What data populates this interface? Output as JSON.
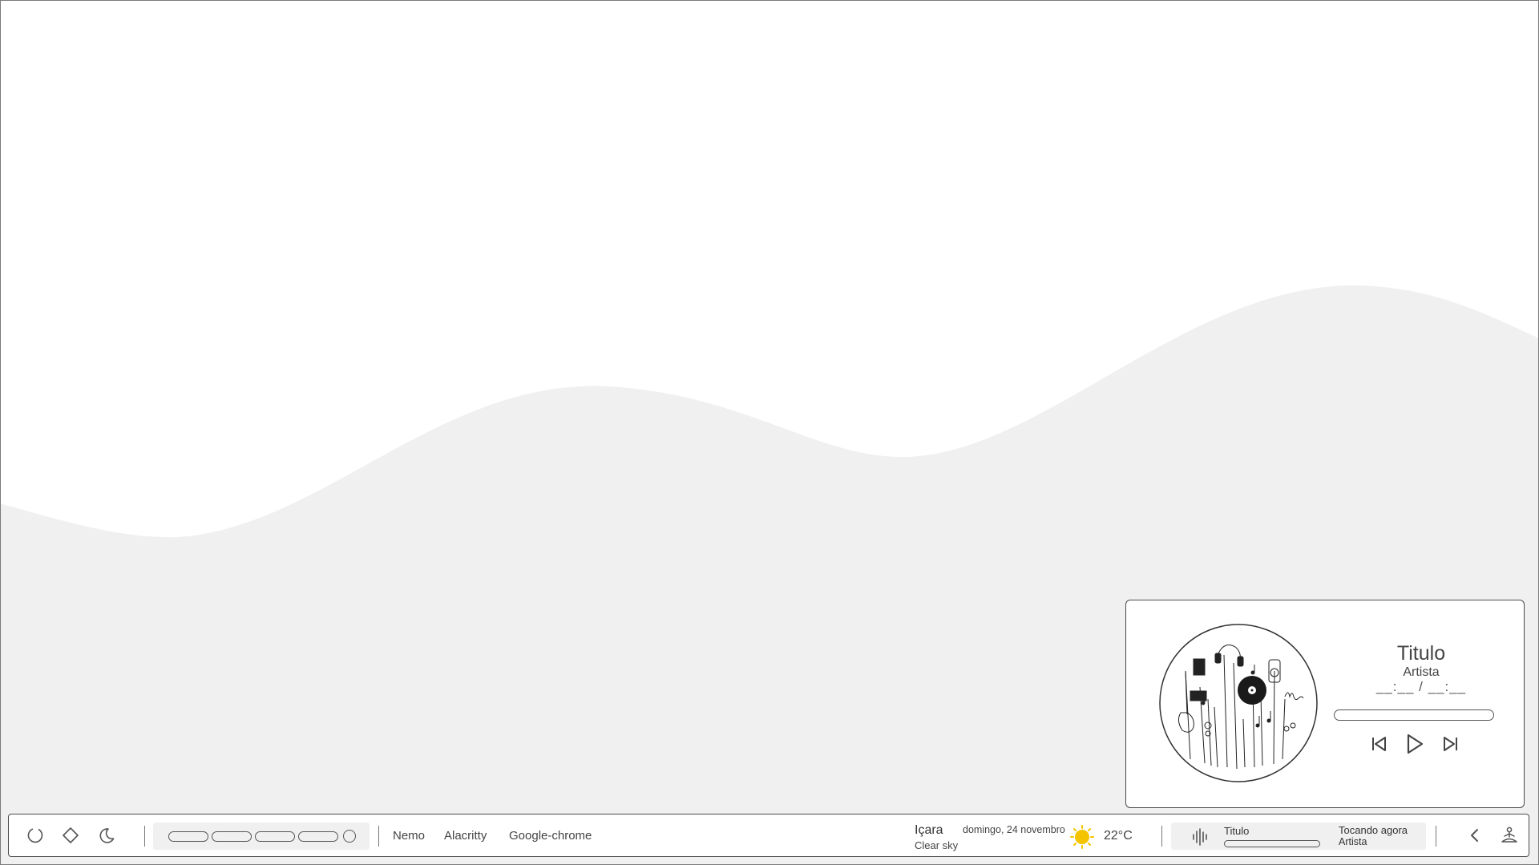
{
  "desktop": {
    "background_color": "#ffffff",
    "wave_color": "#f0f0f0"
  },
  "player": {
    "album_art_icon": "music-doodle-art",
    "title": "Titulo",
    "artist": "Artista",
    "time": "__:__ / __:__",
    "progress": 0,
    "controls": {
      "previous_icon": "skip-previous-icon",
      "play_icon": "play-icon",
      "next_icon": "skip-next-icon"
    }
  },
  "taskbar": {
    "left_icons": [
      "power-circle-icon",
      "diamond-icon",
      "moon-icon"
    ],
    "workspaces": {
      "pill_count": 4,
      "dot_count": 1
    },
    "tasks": [
      "Nemo",
      "Alacritty",
      "Google-chrome"
    ],
    "weather": {
      "city": "Içara",
      "condition": "Clear sky",
      "date": "domingo, 24 novembro",
      "icon": "sun-icon",
      "sun_color": "#f5c400",
      "temperature": "22°C"
    },
    "mini_player": {
      "icon": "audio-wave-icon",
      "title": "Titulo",
      "status": "Tocando agora",
      "artist": "Artista",
      "progress": 0
    },
    "right_icons": [
      "chevron-left-icon",
      "meditation-user-icon"
    ]
  }
}
